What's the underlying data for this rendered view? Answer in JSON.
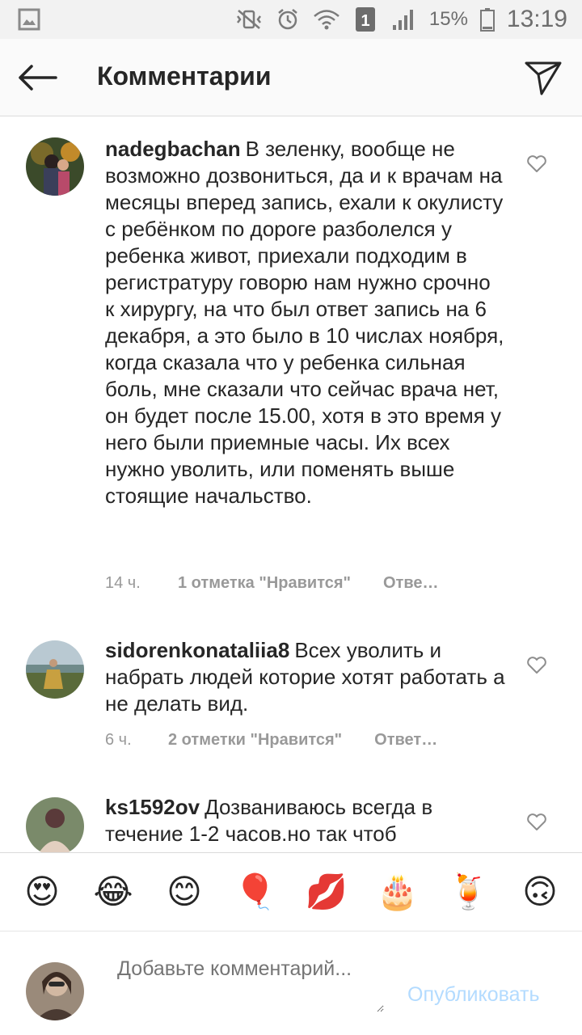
{
  "status_bar": {
    "battery": "15%",
    "time": "13:19",
    "sim_slot": "1"
  },
  "header": {
    "title": "Комментарии"
  },
  "comments": [
    {
      "username": "nadegbachan",
      "text": "В зеленку, вообще не возможно дозвониться, да и к врачам на месяцы вперед запись, ехали к окулисту с ребёнком по дороге разболелся у ребенка живот, приехали подходим в регистратуру говорю нам нужно срочно к хирургу, на что был ответ запись на 6 декабря, а это было в 10 числах ноября, когда сказала что у ребенка сильная боль, мне сказали что сейчас врача нет, он будет после 15.00, хотя в это время у него были приемные часы. Их всех нужно уволить, или поменять выше стоящие начальство.",
      "time": "14 ч.",
      "likes": "1 отметка \"Нравится\"",
      "reply": "Отве…"
    },
    {
      "username": "sidorenkonataliia8",
      "text": "Всех уволить и набрать людей которие хотят работать а не делать вид.",
      "time": "6 ч.",
      "likes": "2 отметки \"Нравится\"",
      "reply": "Ответ…"
    },
    {
      "username": "ks1592ov",
      "text": "Дозваниваюсь всегда в течение 1-2 часов.но так чтоб",
      "time": "",
      "likes": "",
      "reply": ""
    }
  ],
  "emojis": [
    "😍",
    "😂",
    "😊",
    "🎈",
    "💋",
    "🎂",
    "🍹",
    "🙃"
  ],
  "emoji_names": [
    "heart-eyes",
    "tears-of-joy",
    "smiling-blush",
    "balloon",
    "kiss-lips",
    "birthday-cake",
    "cocktail",
    "upside-down-face"
  ],
  "input": {
    "placeholder": "Добавьте комментарий...",
    "publish_label": "Опубликовать"
  },
  "colors": {
    "accent_disabled": "#b3dbff",
    "text": "#262626",
    "muted": "#999999"
  }
}
